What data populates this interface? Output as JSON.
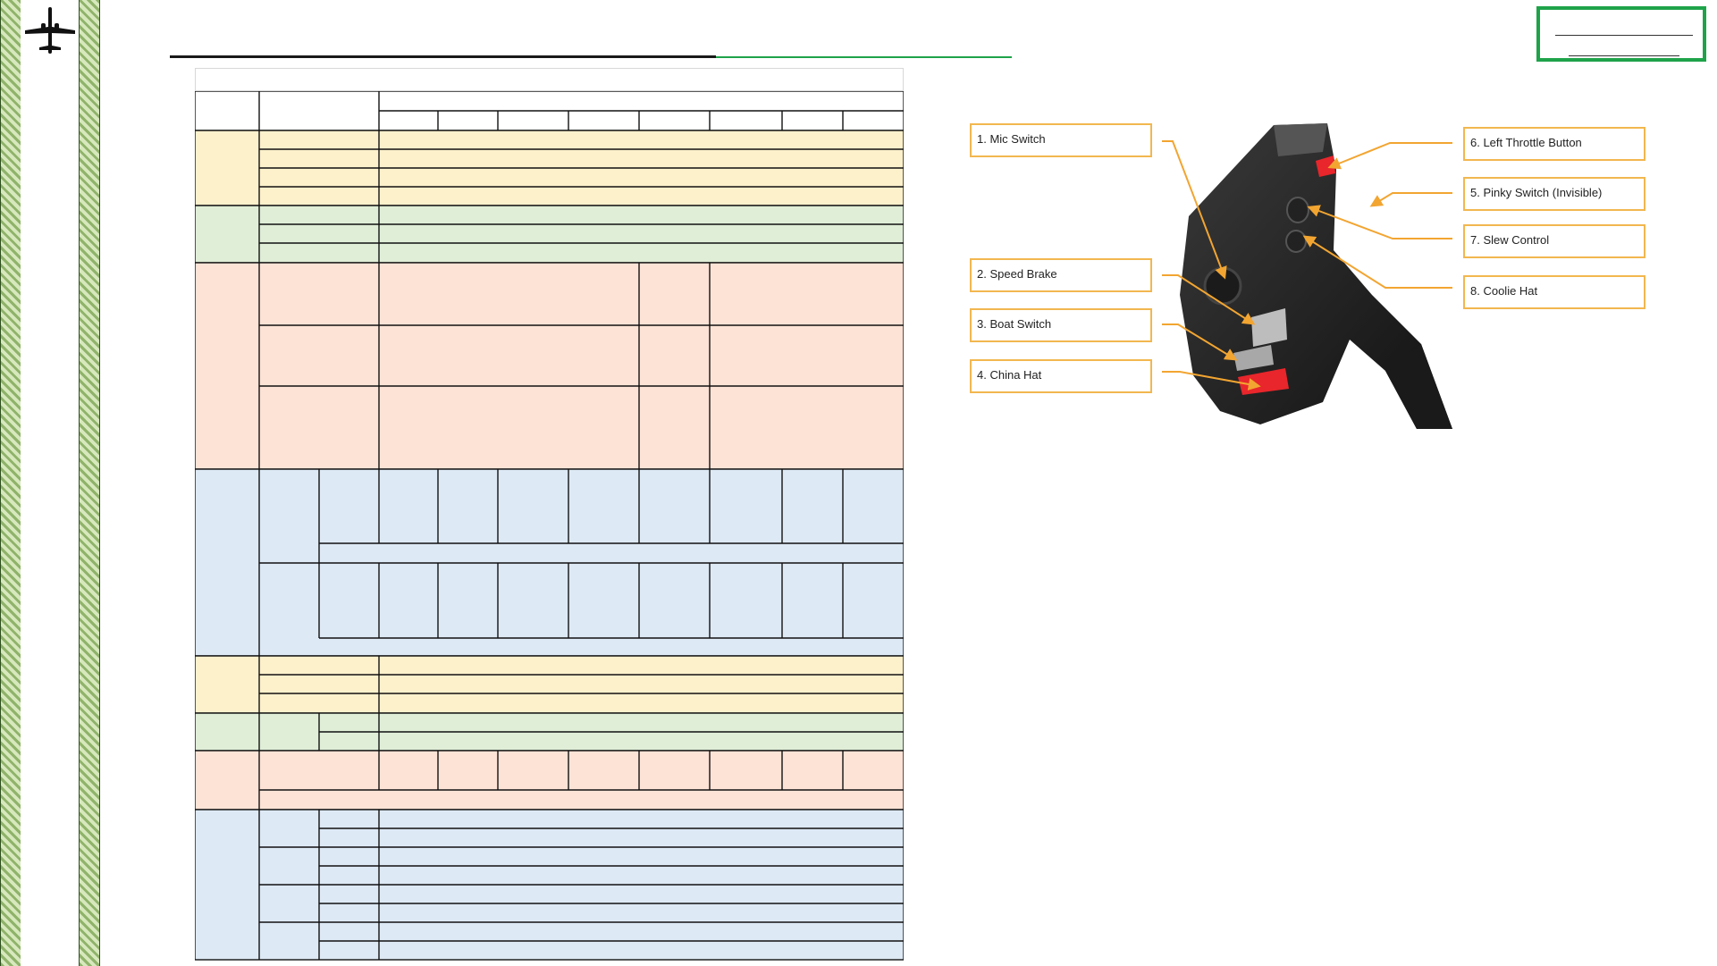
{
  "colors": {
    "band": "#8fb36a",
    "accent_green": "#1fa34a",
    "callout_border": "#f2b74f",
    "table_yellow": "#fdf1cc",
    "table_green": "#e0eed7",
    "table_salmon": "#fde3d6",
    "table_blue": "#dde9f5",
    "button_red": "#e8262b",
    "throttle_body": "#2a2a2a"
  },
  "icons": {
    "logo": "aircraft-silhouette-icon"
  },
  "figure": {
    "callouts": [
      {
        "label": "1. Mic Switch"
      },
      {
        "label": "2. Speed Brake"
      },
      {
        "label": "3. Boat Switch"
      },
      {
        "label": "4. China Hat"
      },
      {
        "label": "6. Left Throttle Button"
      },
      {
        "label": "5. Pinky Switch (Invisible)"
      },
      {
        "label": "7. Slew Control"
      },
      {
        "label": "8. Coolie Hat"
      }
    ]
  }
}
